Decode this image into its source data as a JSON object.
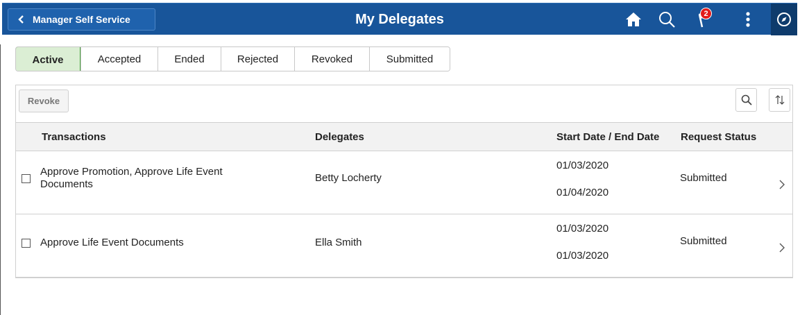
{
  "header": {
    "back_label": "Manager Self Service",
    "title": "My Delegates",
    "notification_count": "2",
    "icons": [
      "back-chevron-icon",
      "home-icon",
      "search-icon",
      "flag-icon",
      "more-vert-icon",
      "compass-icon"
    ],
    "bar_color": "#18559a"
  },
  "tabs": [
    {
      "label": "Active",
      "active": true
    },
    {
      "label": "Accepted"
    },
    {
      "label": "Ended"
    },
    {
      "label": "Rejected"
    },
    {
      "label": "Revoked"
    },
    {
      "label": "Submitted"
    }
  ],
  "toolbar": {
    "revoke_label": "Revoke",
    "icons": [
      "search-icon",
      "sort-icon"
    ]
  },
  "grid": {
    "columns": [
      "Transactions",
      "Delegates",
      "Start Date / End Date",
      "Request Status"
    ],
    "rows": [
      {
        "transactions_line1": "Approve Promotion, Approve Life Event",
        "transactions_line2": "Documents",
        "delegate": "Betty Locherty",
        "start_date": "01/03/2020",
        "end_date": "01/04/2020",
        "status": "Submitted"
      },
      {
        "transactions_line1": "Approve Life Event Documents",
        "transactions_line2": "",
        "delegate": "Ella Smith",
        "start_date": "01/03/2020",
        "end_date": "01/03/2020",
        "status": "Submitted"
      }
    ]
  },
  "colors": {
    "active_tab_bg": "#dbeed4",
    "active_tab_border": "#4aa340",
    "badge": "#e21b1b"
  }
}
